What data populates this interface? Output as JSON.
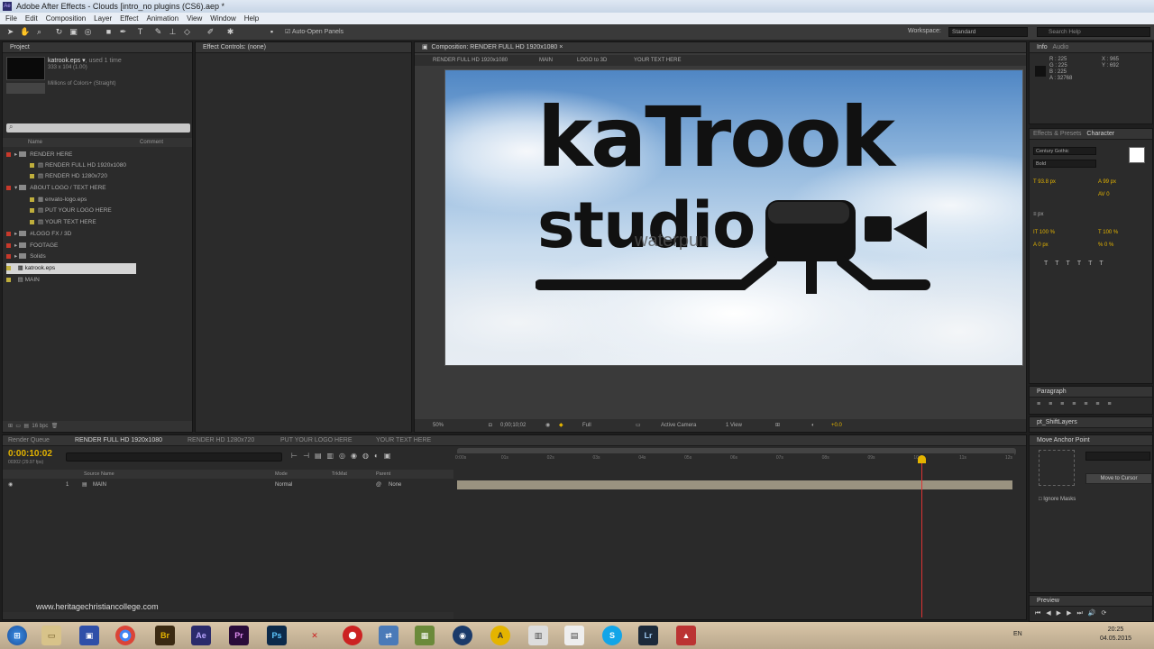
{
  "window": {
    "title": "Adobe After Effects - Clouds [intro_no plugins (CS6).aep *"
  },
  "menu": [
    "File",
    "Edit",
    "Composition",
    "Layer",
    "Effect",
    "Animation",
    "View",
    "Window",
    "Help"
  ],
  "toolbar": {
    "auto_open_panels": "Auto-Open Panels",
    "workspace_label": "Workspace:",
    "workspace_value": "Standard",
    "search_placeholder": "Search Help"
  },
  "project": {
    "tab": "Project",
    "selected_name": "katrook.eps ▾",
    "used": ", used 1 time",
    "dims": "333 x 104 (1.00)",
    "colors": "Millions of Colors+ (Straight)",
    "col_name": "Name",
    "col_comment": "Comment",
    "items": [
      "RENDER HERE",
      "RENDER FULL HD 1920x1080",
      "RENDER HD 1280x720",
      "ABOUT LOGO / TEXT HERE",
      "envato-logo.eps",
      "PUT YOUR LOGO HERE",
      "YOUR TEXT HERE",
      "#LOGO FX / 3D",
      "FOOTAGE",
      "Solids",
      "katrook.eps",
      "MAIN"
    ],
    "bpc": "16 bpc"
  },
  "effect_controls": {
    "tab": "Effect Controls: (none)"
  },
  "composition": {
    "tab": "Composition: RENDER FULL HD 1920x1080",
    "breadcrumbs": [
      "RENDER FULL HD 1920x1080",
      "MAIN",
      "LOGO to 3D",
      "YOUR TEXT HERE"
    ],
    "logo_line1": "kaTrook",
    "logo_line2": "studio",
    "logo_sub": "waterpun",
    "zoom": "50%",
    "timecode": "0;00;10;02",
    "resolution": "Full",
    "camera": "Active Camera",
    "views": "1 View",
    "exposure": "+0.0"
  },
  "info": {
    "tab": "Info",
    "tab2": "Audio",
    "r": "R : 225",
    "g": "G : 225",
    "b": "B : 225",
    "a": "A : 32768",
    "x": "X : 965",
    "y": "Y : 692"
  },
  "right_tabs": [
    "Effects & Presets",
    "Character"
  ],
  "character": {
    "font": "Century Gothic",
    "style": "Bold",
    "size": "93.8 px",
    "leading": "99 px",
    "tracking": "0",
    "unit": "px",
    "v_scale": "100 %",
    "h_scale": "100 %",
    "baseline": "0 px",
    "tsume": "0 %"
  },
  "paragraph": {
    "tab": "Paragraph"
  },
  "pt_shift": {
    "tab": "pt_ShiftLayers"
  },
  "move_anchor": {
    "tab": "Move Anchor Point",
    "move_btn": "Move to Cursor",
    "ignore_masks": "Ignore Masks"
  },
  "preview": {
    "tab": "Preview"
  },
  "timeline": {
    "tabs": [
      "Render Queue",
      "RENDER FULL HD 1920x1080",
      "RENDER HD 1280x720",
      "PUT YOUR LOGO HERE",
      "YOUR TEXT HERE"
    ],
    "timecode": "0:00:10:02",
    "fps": "00302 (29.97 fps)",
    "col_source": "Source Name",
    "col_mode": "Mode",
    "col_trkmat": "TrkMat",
    "col_parent": "Parent",
    "layer_num": "1",
    "layer_name": "MAIN",
    "layer_mode": "Normal",
    "layer_parent": "None",
    "ruler": [
      "0:00s",
      "01s",
      "02s",
      "03s",
      "04s",
      "05s",
      "06s",
      "07s",
      "08s",
      "09s",
      "10s",
      "11s",
      "12s"
    ],
    "playhead_fraction": 0.84
  },
  "watermark": "www.heritagechristiancollege.com",
  "tray": {
    "lang": "EN",
    "time": "20:25",
    "date": "04.05.2015"
  }
}
